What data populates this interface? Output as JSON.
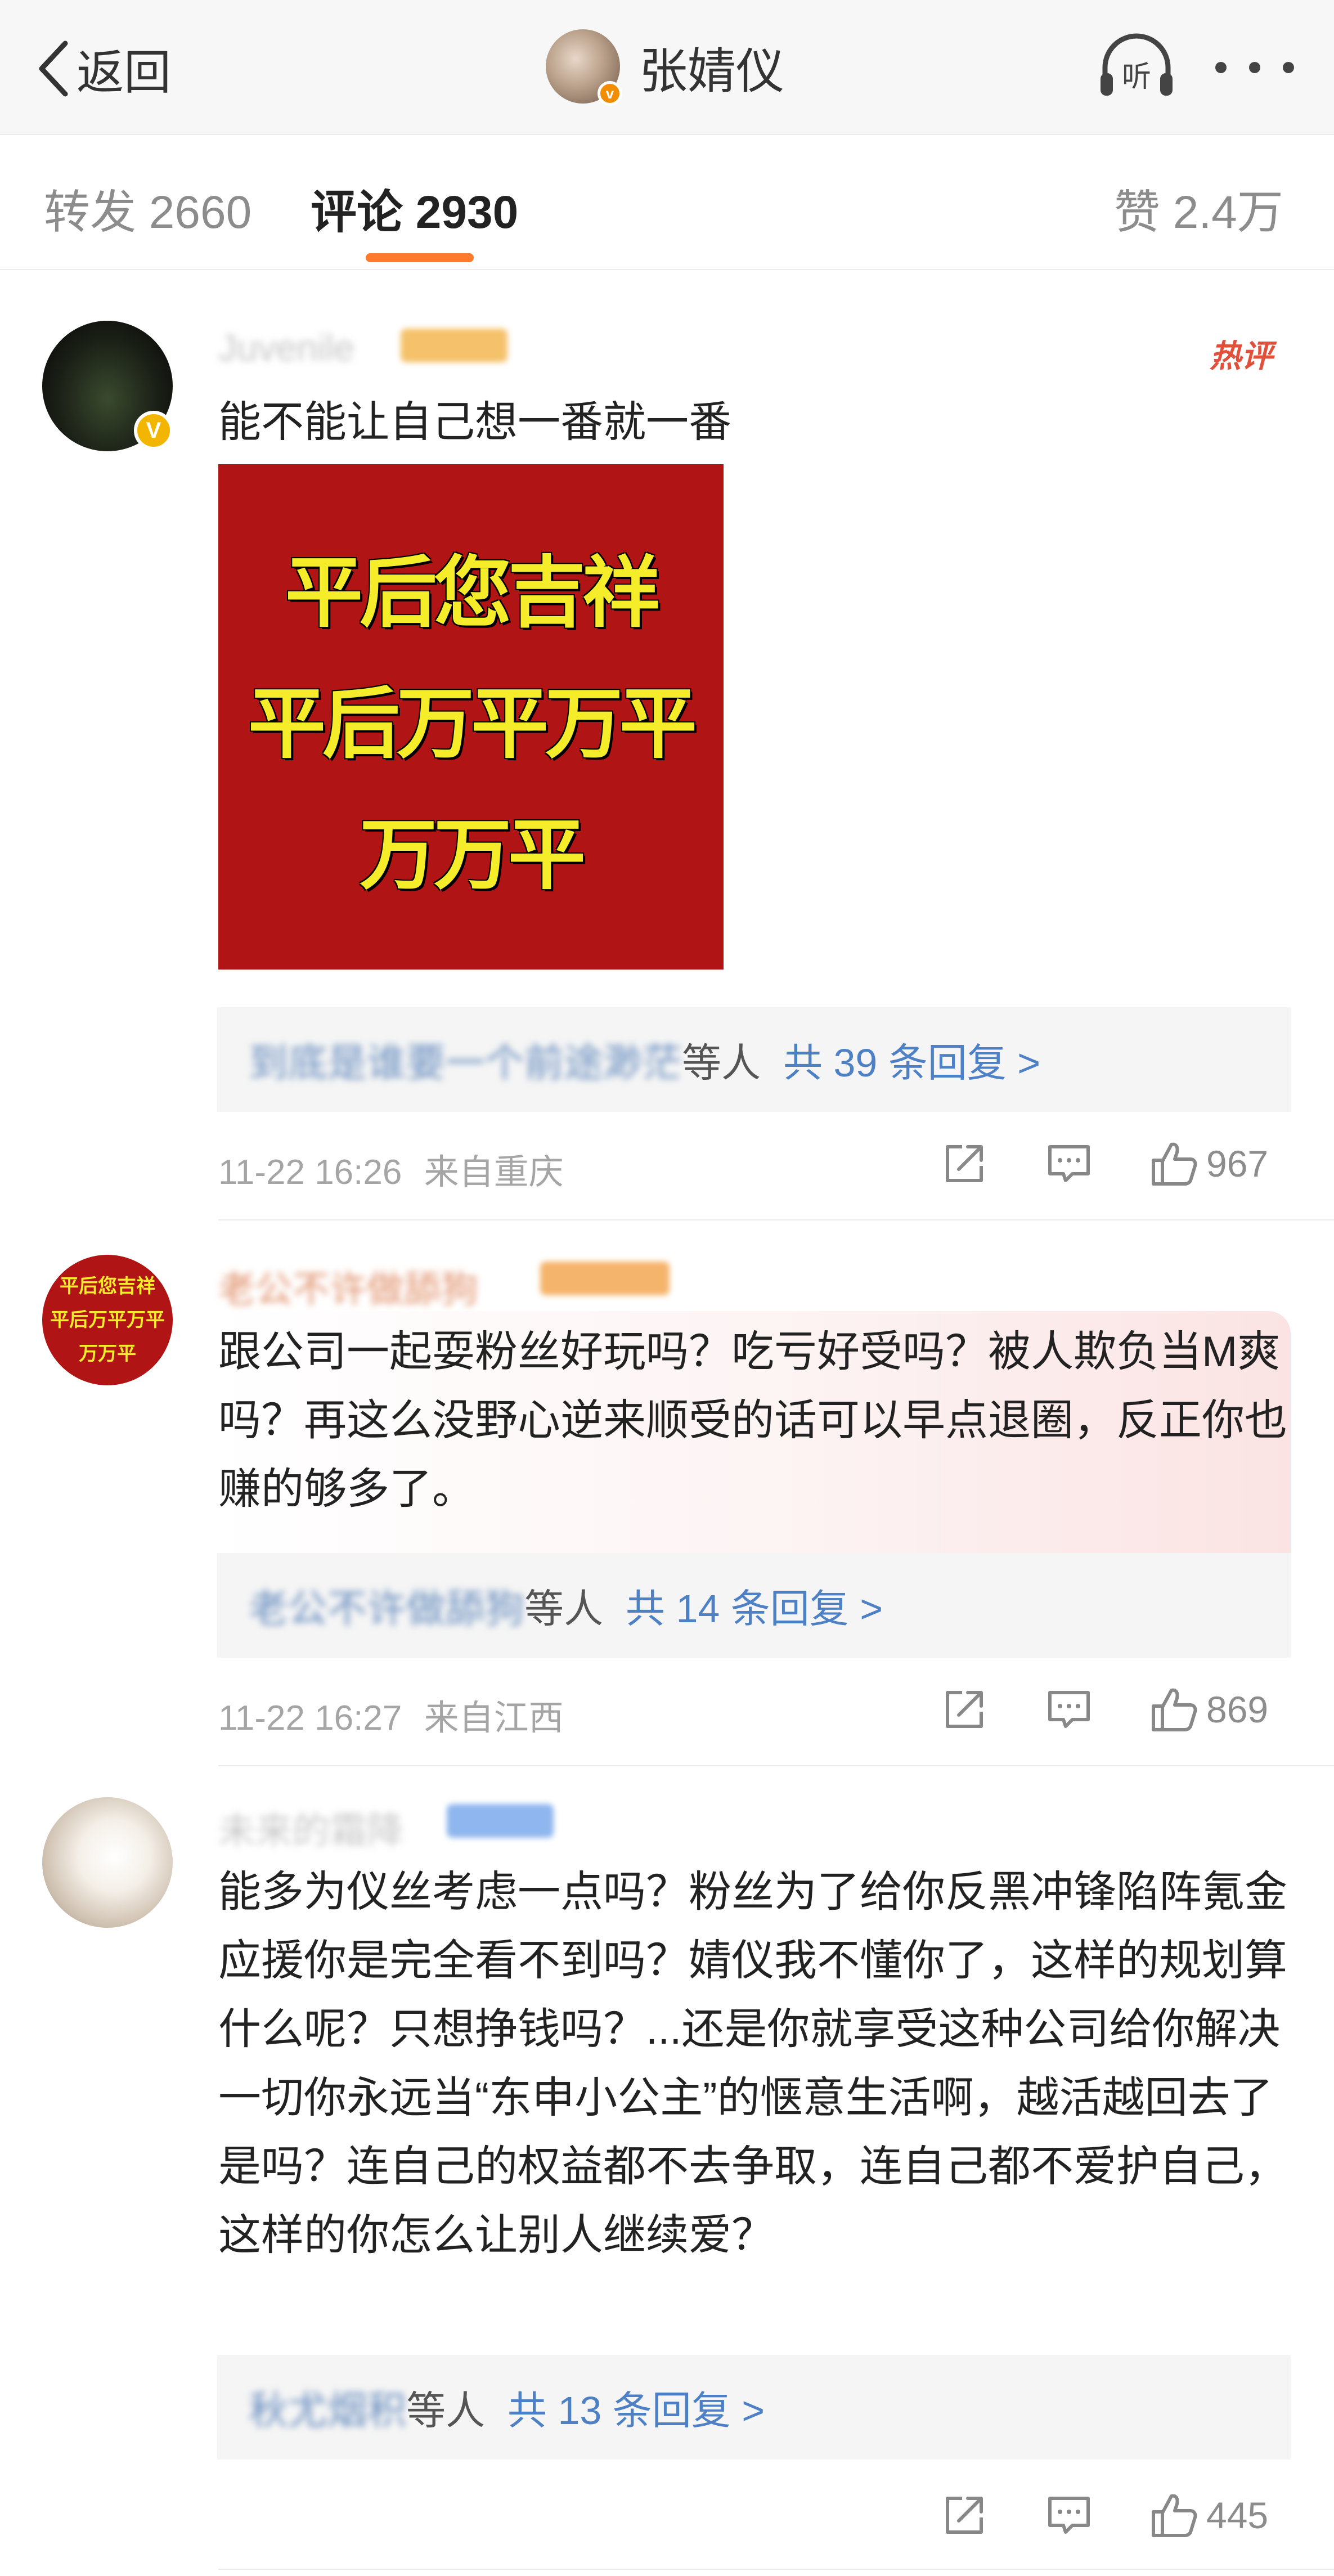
{
  "nav": {
    "back_label": "返回",
    "profile_name": "张婧仪",
    "listen_label": "听"
  },
  "tabs": [
    {
      "label": "转发 2660"
    },
    {
      "label": "评论 2930"
    },
    {
      "label": "赞 2.4万"
    }
  ],
  "accent_color": "#ff7a2b",
  "comments": [
    {
      "username": "Juvenile",
      "hot_tag": "热评",
      "text": "能不能让自己想一番就一番",
      "image_lines": [
        "平后您吉祥",
        "平后万平万平",
        "万万平"
      ],
      "reply_names": "到底是谁要一个前途渺茫",
      "reply_others": "等人",
      "reply_count": "共 39 条回复 >",
      "time": "11-22 16:26",
      "location": "来自重庆",
      "likes": "967"
    },
    {
      "username": "老公不许做舔狗",
      "avatar_lines": [
        "平后您吉祥",
        "平后万平万平",
        "万万平"
      ],
      "text": "跟公司一起耍粉丝好玩吗？吃亏好受吗？被人欺负当M爽吗？再这么没野心逆来顺受的话可以早点退圈，反正你也赚的够多了。",
      "reply_names": "老公不许做舔狗",
      "reply_others": "等人",
      "reply_count": "共 14 条回复 >",
      "time": "11-22 16:27",
      "location": "来自江西",
      "likes": "869"
    },
    {
      "username": "未来的霜降",
      "text": "能多为仪丝考虑一点吗？粉丝为了给你反黑冲锋陷阵氪金应援你是完全看不到吗？婧仪我不懂你了，这样的规划算什么呢？只想挣钱吗？...还是你就享受这种公司给你解决一切你永远当“东申小公主”的惬意生活啊，越活越回去了是吗？连自己的权益都不去争取，连自己都不爱护自己，这样的你怎么让别人继续爱？",
      "reply_names": "秋尤烟积",
      "reply_others": "等人",
      "reply_count": "共 13 条回复 >",
      "time": "",
      "location": "",
      "likes": "445"
    }
  ]
}
